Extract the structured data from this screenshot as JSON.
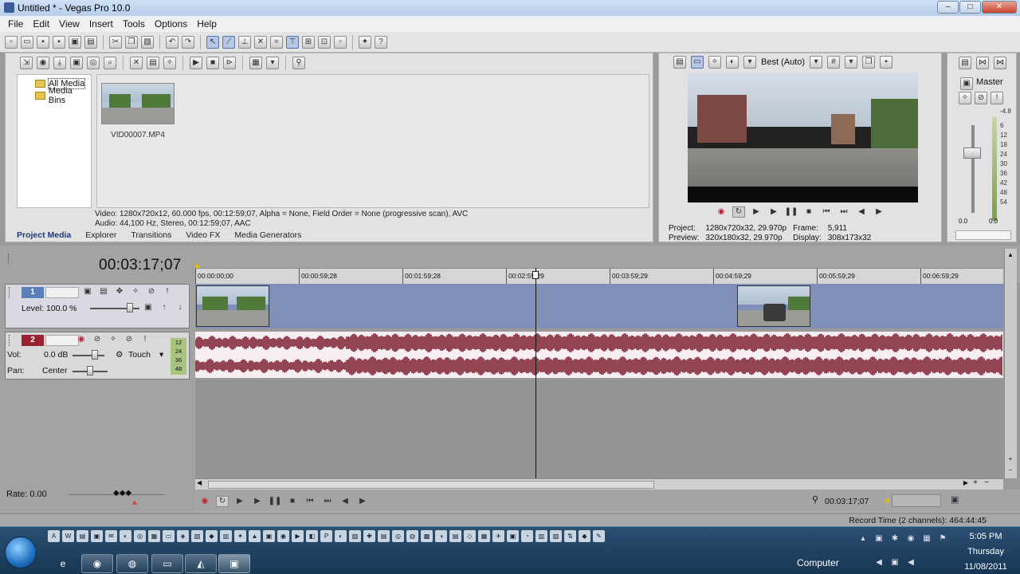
{
  "window": {
    "title": "Untitled * - Vegas Pro 10.0",
    "minimize": "–",
    "maximize": "□",
    "close": "✕"
  },
  "menu": [
    "File",
    "Edit",
    "View",
    "Insert",
    "Tools",
    "Options",
    "Help"
  ],
  "project_media": {
    "tree": [
      {
        "label": "All Media",
        "selected": true
      },
      {
        "label": "Media Bins",
        "selected": false
      }
    ],
    "media_file": "VID00007.MP4",
    "info_video": "Video: 1280x720x12, 60.000 fps, 00:12:59;07, Alpha = None, Field Order = None (progressive scan), AVC",
    "info_audio": "Audio: 44,100 Hz, Stereo, 00:12:59;07, AAC",
    "tabs": [
      {
        "label": "Project Media",
        "active": true
      },
      {
        "label": "Explorer",
        "active": false
      },
      {
        "label": "Transitions",
        "active": false
      },
      {
        "label": "Video FX",
        "active": false
      },
      {
        "label": "Media Generators",
        "active": false
      }
    ]
  },
  "preview": {
    "quality": "Best (Auto)",
    "project_label": "Project:",
    "project_value": "1280x720x32, 29.970p",
    "preview_label": "Preview:",
    "preview_value": "320x180x32, 29.970p",
    "frame_label": "Frame:",
    "frame_value": "5,911",
    "display_label": "Display:",
    "display_value": "308x173x32"
  },
  "mixer": {
    "label": "Master",
    "scale": [
      "-4.8",
      "6",
      "12",
      "18",
      "24",
      "30",
      "36",
      "42",
      "48",
      "54",
      "0.0",
      "0.0"
    ]
  },
  "timeline": {
    "current_time": "00:03:17;07",
    "ruler": [
      "00:00:00;00",
      "00:00:59;28",
      "00:01:59;28",
      "00:02:59;29",
      "00:03:59;29",
      "00:04:59;29",
      "00:05:59;29",
      "00:06:59;29"
    ],
    "video_track": {
      "number": "1",
      "level_label": "Level:",
      "level_value": "100.0 %",
      "color": "#5b7fb8"
    },
    "audio_track": {
      "number": "2",
      "vol_label": "Vol:",
      "vol_value": "0.0 dB",
      "pan_label": "Pan:",
      "pan_value": "Center",
      "automation": "Touch",
      "vu": [
        "12",
        "24",
        "36",
        "48"
      ],
      "color": "#9b2130"
    },
    "rate": "Rate: 0.00",
    "cursor_time": "00:03:17;07",
    "record_time": "Record Time (2 channels): 464:44:45"
  },
  "taskbar": {
    "computer": "Computer",
    "time": "5:05 PM",
    "day": "Thursday",
    "date": "11/08/2011"
  },
  "colors": {
    "accent": "#1b3b7a",
    "video_lane": "#7f8fb8",
    "audio_lane": "#a78d95",
    "waveform": "#7b1a2a"
  }
}
